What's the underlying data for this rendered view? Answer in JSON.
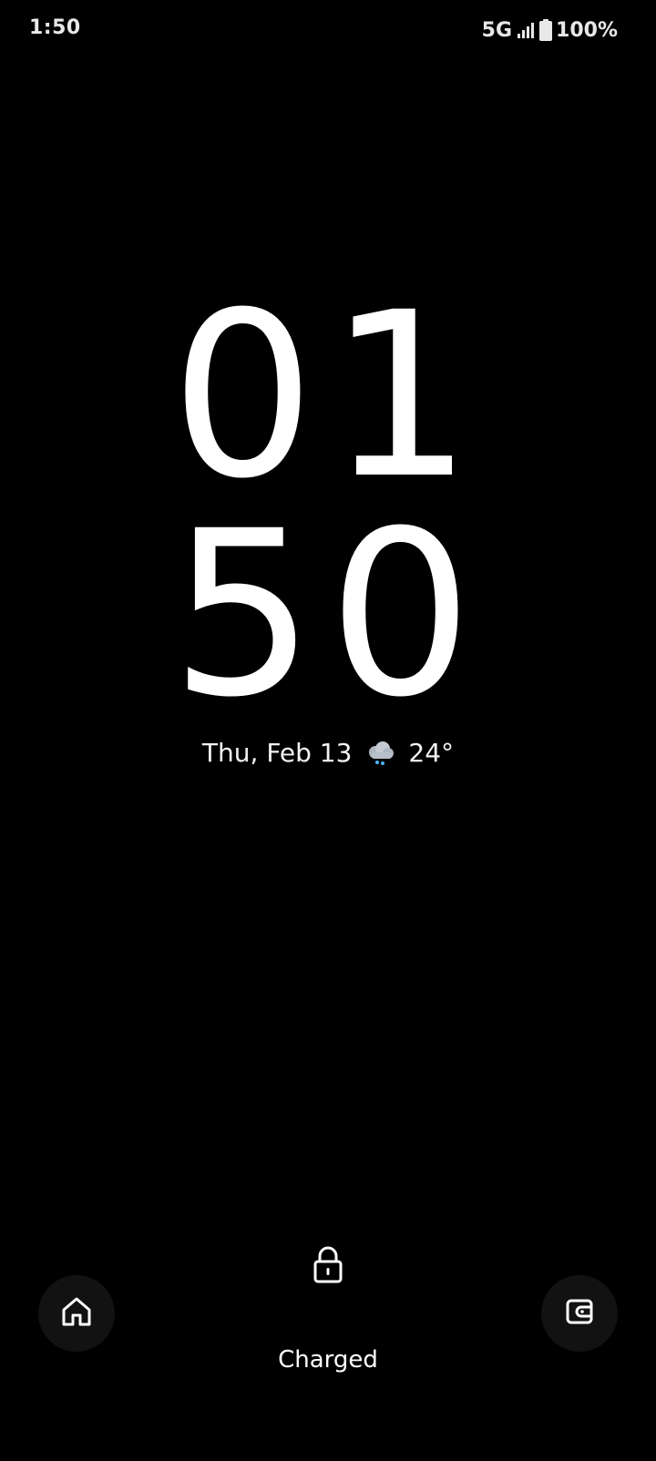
{
  "status_bar": {
    "time": "1:50",
    "network": "5G",
    "battery": "100%",
    "signal_icon": "signal-bars-icon",
    "battery_icon": "battery-full-icon"
  },
  "clock": {
    "hours": "01",
    "minutes": "50"
  },
  "date_weather": {
    "date": "Thu, Feb 13",
    "weather_icon": "cloud-drizzle-icon",
    "temperature": "24°"
  },
  "bottom": {
    "lock_icon": "lock-icon",
    "left_shortcut_icon": "home-icon",
    "right_shortcut_icon": "wallet-icon",
    "charging_text": "Charged"
  },
  "colors": {
    "background": "#000000",
    "text": "#ffffff",
    "shortcut_bg": "#121212"
  }
}
